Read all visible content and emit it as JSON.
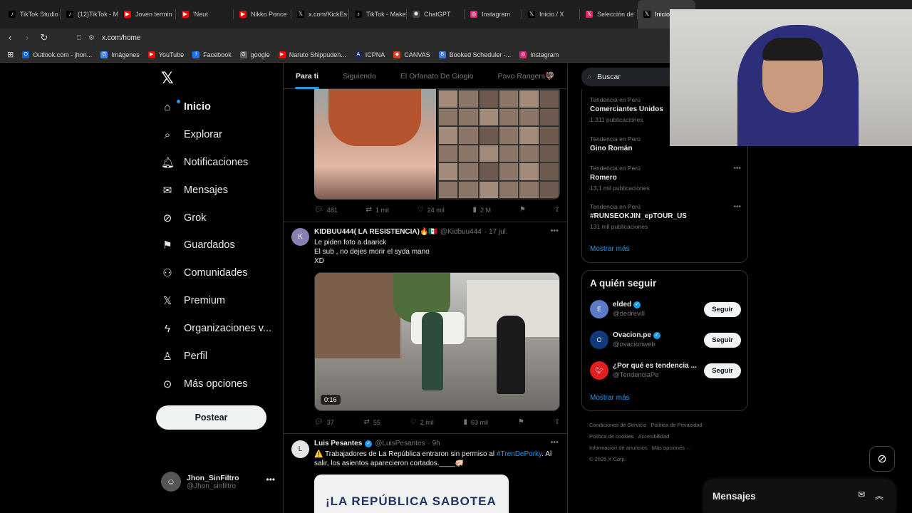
{
  "browser": {
    "tabs": [
      {
        "label": "TikTok Studio",
        "icon": "tiktok-icon",
        "color": "#000000"
      },
      {
        "label": "(12)TikTok - M",
        "icon": "tiktok-icon",
        "color": "#000000"
      },
      {
        "label": "Joven termin",
        "icon": "youtube-icon",
        "color": "#ff0000"
      },
      {
        "label": "'Neut",
        "icon": "youtube-icon",
        "color": "#ff0000"
      },
      {
        "label": "Nikko Ponce",
        "icon": "youtube-icon",
        "color": "#ff0000"
      },
      {
        "label": "x.com/KickEs",
        "icon": "x-icon",
        "color": "#000000"
      },
      {
        "label": "TikTok - Make",
        "icon": "tiktok-icon",
        "color": "#000000"
      },
      {
        "label": "ChatGPT",
        "icon": "chatgpt-icon",
        "color": "#444444"
      },
      {
        "label": "Instagram",
        "icon": "instagram-icon",
        "color": "#d62976"
      },
      {
        "label": "Inicio / X",
        "icon": "x-icon",
        "color": "#000000"
      },
      {
        "label": "Selección de",
        "icon": "x-icon",
        "color": "#e0245e"
      },
      {
        "label": "Inicio",
        "icon": "x-icon",
        "color": "#000000",
        "active": true
      }
    ],
    "url": "x.com/home",
    "bookmarks": [
      {
        "label": "Outlook.com - jhon...",
        "icon": "outlook-icon",
        "color": "#0a64d6"
      },
      {
        "label": "Imágenes",
        "icon": "google-icon",
        "color": "#4285f4"
      },
      {
        "label": "YouTube",
        "icon": "youtube-icon",
        "color": "#ff0000"
      },
      {
        "label": "Facebook",
        "icon": "facebook-icon",
        "color": "#1877f2"
      },
      {
        "label": "google",
        "icon": "globe-icon",
        "color": "#5f6368"
      },
      {
        "label": "Naruto Shippuden...",
        "icon": "youtube-icon",
        "color": "#ff0000"
      },
      {
        "label": "ICPNA",
        "icon": "icpna-icon",
        "color": "#1c2a5a"
      },
      {
        "label": "CANVAS",
        "icon": "canvas-icon",
        "color": "#e43b1d"
      },
      {
        "label": "Booked Scheduler -...",
        "icon": "booked-icon",
        "color": "#3b7dd8"
      },
      {
        "label": "Instagram",
        "icon": "instagram-icon",
        "color": "#d62976"
      }
    ]
  },
  "nav": {
    "items": [
      {
        "label": "Inicio",
        "icon": "home-icon",
        "bold": true
      },
      {
        "label": "Explorar",
        "icon": "search-icon"
      },
      {
        "label": "Notificaciones",
        "icon": "bell-icon"
      },
      {
        "label": "Mensajes",
        "icon": "mail-icon"
      },
      {
        "label": "Grok",
        "icon": "grok-icon"
      },
      {
        "label": "Guardados",
        "icon": "bookmark-icon"
      },
      {
        "label": "Comunidades",
        "icon": "communities-icon"
      },
      {
        "label": "Premium",
        "icon": "x-icon"
      },
      {
        "label": "Organizaciones v...",
        "icon": "lightning-icon"
      },
      {
        "label": "Perfil",
        "icon": "person-icon"
      },
      {
        "label": "Más opciones",
        "icon": "more-circle-icon"
      }
    ],
    "post_label": "Postear",
    "profile": {
      "name": "Jhon_SinFiltro",
      "handle": "@Jhon_sinfiltro"
    }
  },
  "feed": {
    "tabs": [
      "Para ti",
      "Siguiendo",
      "El Orfanato De Giogio",
      "Pavo Rangers🦃"
    ],
    "tweet1": {
      "replies": "481",
      "reposts": "1 mil",
      "likes": "24 mil",
      "views": "2 M"
    },
    "tweet2": {
      "name": "KIDBUU444( LA RESISTENCIA)🔥🇲🇽",
      "handle": "@Kidbuu444",
      "time": "· 17 jul.",
      "lines": [
        "Le piden foto a daarick",
        "El sub , no dejes morir el syda mano",
        "XD"
      ],
      "duration": "0:16",
      "replies": "37",
      "reposts": "55",
      "likes": "2 mil",
      "views": "63 mil"
    },
    "tweet3": {
      "name": "Luis Pesantes",
      "handle": "@LuisPesantes",
      "time": "· 9h",
      "text_pre": "⚠️ Trabajadores de La República entraron sin permiso al ",
      "hashtag": "#TrenDePorky",
      "text_post": ". Al salir, los asientos aparecieron cortados.____🐖",
      "card_headline": "¡LA REPÚBLICA SABOTEA"
    }
  },
  "sidebar": {
    "search_placeholder": "Buscar",
    "trends": [
      {
        "context": "Tendencia en Perú",
        "title": "Comerciantes Unidos",
        "count": "1.311 publicaciones"
      },
      {
        "context": "Tendencia en Perú",
        "title": "Gino Román",
        "count": ""
      },
      {
        "context": "Tendencia en Perú",
        "title": "Romero",
        "count": "13,1 mil publicaciones"
      },
      {
        "context": "Tendencia en Perú",
        "title": "#RUNSEOKJIN_epTOUR_US",
        "count": "131 mil publicaciones"
      }
    ],
    "trends_show_more": "Mostrar más",
    "who_to_follow": {
      "title": "A quién seguir",
      "accounts": [
        {
          "name": "elded",
          "handle": "@dedrevill",
          "verified": true,
          "avatar_color": "#5b7cc4"
        },
        {
          "name": "Ovacion.pe",
          "handle": "@ovacionweb",
          "verified": true,
          "avatar_color": "#123a7a"
        },
        {
          "name": "¿Por qué es tendencia ...",
          "handle": "@TendenciaPe",
          "verified": false,
          "avatar_color": "#e0201f"
        }
      ],
      "follow_label": "Seguir",
      "show_more": "Mostrar más"
    },
    "footer": {
      "links": [
        "Condiciones de Servicio",
        "Política de Privacidad",
        "Política de cookies",
        "Accesibilidad",
        "Información de anuncios",
        "Más opciones ···"
      ],
      "copyright": "© 2025 X Corp."
    }
  },
  "messages_drawer": {
    "title": "Mensajes"
  }
}
